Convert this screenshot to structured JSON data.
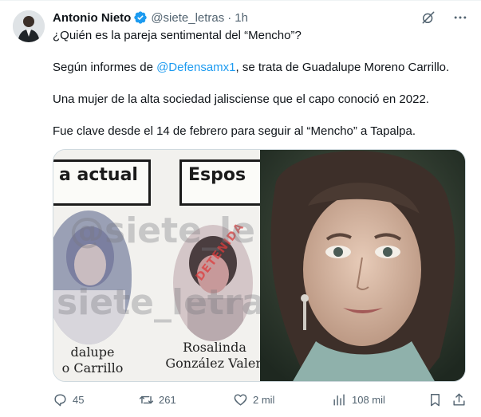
{
  "author": {
    "name": "Antonio Nieto",
    "handle": "@siete_letras",
    "dot": "·",
    "time": "1h"
  },
  "tweet": {
    "line1": "¿Quién es la pareja sentimental del “Mencho”?",
    "line2_before": "Según informes de ",
    "line2_link": "@Defensamx1",
    "line2_after": ", se trata de Guadalupe Moreno Carrillo.",
    "line3": "Una mujer de la alta sociedad jalisciense que el capo conoció en 2022.",
    "line4": "Fue clave desde el 14 de febrero para seguir al “Mencho” a Tapalpa."
  },
  "media": {
    "left": {
      "label_1": "a actual",
      "label_2": "Espos",
      "watermark_1": "@siete_le",
      "watermark_2": "siete_letras",
      "caption_1": "dalupe\no Carrillo",
      "caption_2": "Rosalinda\nGonzález Valen",
      "stamp": "DETENIDA"
    }
  },
  "actions": {
    "replies": "45",
    "reposts": "261",
    "likes": "2 mil",
    "views": "108 mil"
  },
  "colors": {
    "accent": "#1d9bf0",
    "verified": "#1d9bf0",
    "muted": "#536471",
    "text": "#0f1419"
  },
  "icons": {
    "verified": "verified-badge-icon",
    "grok": "grok-icon",
    "more": "more-icon",
    "reply": "reply-icon",
    "repost": "repost-icon",
    "like": "like-icon",
    "views": "views-icon",
    "bookmark": "bookmark-icon",
    "share": "share-icon"
  }
}
